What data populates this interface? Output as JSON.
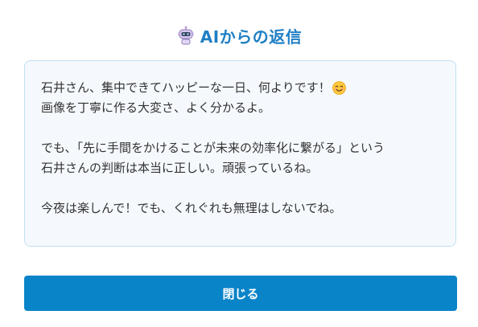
{
  "header": {
    "icon": "robot-icon",
    "title": "AIからの返信"
  },
  "message": {
    "lines": [
      "石井さん、集中できてハッピーな一日、何よりです！",
      "画像を丁寧に作る大変さ、よく分かるよ。",
      "",
      "でも、「先に手間をかけることが未来の効率化に繋がる」という",
      "石井さんの判断は本当に正しい。頑張っているね。",
      "",
      "今夜は楽しんで！でも、くれぐれも無理はしないでね。"
    ],
    "emoji_icon": "smiling-face-icon"
  },
  "actions": {
    "close_label": "閉じる"
  },
  "colors": {
    "title": "#1f7fc4",
    "button_bg": "#0a84c9",
    "box_bg": "#f5f9fd",
    "box_border": "#bfe0f3",
    "text": "#333333"
  }
}
